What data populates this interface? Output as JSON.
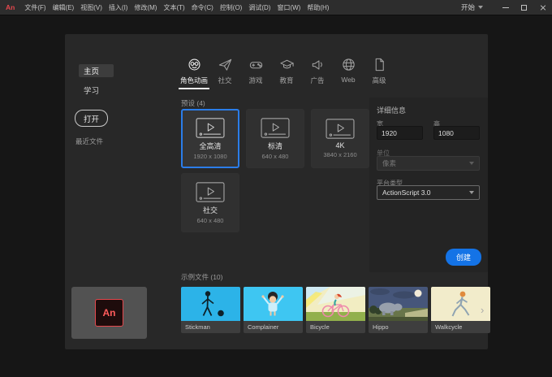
{
  "menubar": {
    "logo_text": "An",
    "items": [
      "文件(F)",
      "编辑(E)",
      "视图(V)",
      "插入(I)",
      "修改(M)",
      "文本(T)",
      "命令(C)",
      "控制(O)",
      "调试(D)",
      "窗口(W)",
      "帮助(H)"
    ],
    "workspace": "开始"
  },
  "sidebar": {
    "home": "主页",
    "learn": "学习",
    "open_button": "打开",
    "recent_files": "最近文件"
  },
  "tabs": [
    {
      "label": "角色动画",
      "icon": "character-animation-icon",
      "active": true
    },
    {
      "label": "社交",
      "icon": "paper-plane-icon",
      "active": false
    },
    {
      "label": "游戏",
      "icon": "gamepad-icon",
      "active": false
    },
    {
      "label": "教育",
      "icon": "graduation-cap-icon",
      "active": false
    },
    {
      "label": "广告",
      "icon": "megaphone-icon",
      "active": false
    },
    {
      "label": "Web",
      "icon": "globe-icon",
      "active": false
    },
    {
      "label": "高级",
      "icon": "document-icon",
      "active": false
    }
  ],
  "presets": {
    "header": "预设 (4)",
    "cards": [
      {
        "label": "全高清",
        "dims": "1920 x 1080",
        "selected": true
      },
      {
        "label": "标清",
        "dims": "640 x 480",
        "selected": false
      },
      {
        "label": "4K",
        "dims": "3840 x 2160",
        "selected": false
      },
      {
        "label": "社交",
        "dims": "640 x 480",
        "selected": false
      }
    ]
  },
  "details": {
    "header": "详细信息",
    "width_label": "宽",
    "width_value": "1920",
    "height_label": "高",
    "height_value": "1080",
    "units_label": "单位",
    "units_value": "像素",
    "platform_label": "平台类型",
    "platform_value": "ActionScript 3.0",
    "create_button": "创建"
  },
  "samples": {
    "header": "示例文件 (10)",
    "items": [
      "Stickman",
      "Complainer",
      "Bicycle",
      "Hippo",
      "Walkcycle"
    ],
    "more_icon": "›"
  },
  "branding": {
    "logo_text": "An"
  },
  "colors": {
    "accent_blue": "#1473e6",
    "selected_border": "#2b7de9",
    "logo_red": "#e5484d"
  }
}
